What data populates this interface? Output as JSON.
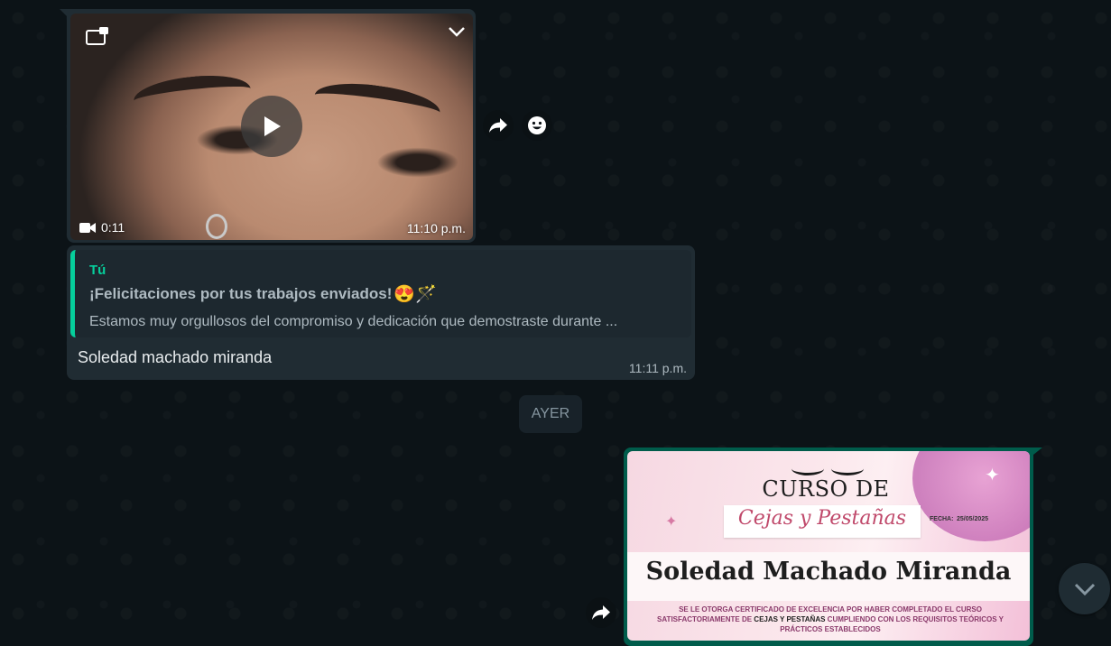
{
  "video_message": {
    "duration": "0:11",
    "time": "11:10 p.m."
  },
  "reply_message": {
    "quote_author": "Tú",
    "quote_title": "¡Felicitaciones por tus trabajos enviados!",
    "quote_emojis": "😍🪄",
    "quote_text": "Estamos muy orgullosos del compromiso y dedicación que demostraste durante ...",
    "text": "Soledad machado miranda",
    "time": "11:11 p.m."
  },
  "date_divider": "AYER",
  "image_message": {
    "heading": "CURSO DE",
    "script_title": "Cejas y Pestañas",
    "date_label": "FECHA:",
    "date_value": "25/05/2025",
    "recipient_name": "Soledad Machado Miranda",
    "body_line1": "SE LE OTORGA CERTIFICADO DE EXCELENCIA POR HABER COMPLETADO EL CURSO",
    "body_line2_pre": "SATISFACTORIAMENTE  DE ",
    "body_line2_bold": "CEJAS Y PESTAÑAS",
    "body_line2_post": " CUMPLIENDO CON LOS REQUISITOS TEÓRICOS Y",
    "body_line3": "PRÁCTICOS ESTABLECIDOS"
  },
  "icons": {
    "popout": "popout-icon",
    "chevron": "chevron-down-icon",
    "play": "play-icon",
    "video_camera": "video-camera-icon",
    "forward": "forward-icon",
    "emoji": "emoji-icon",
    "scroll_down": "chevron-down-icon"
  },
  "colors": {
    "background": "#0c1317",
    "incoming_bubble": "#202c33",
    "outgoing_bubble": "#005c4b",
    "quote_accent": "#06cf9c"
  }
}
